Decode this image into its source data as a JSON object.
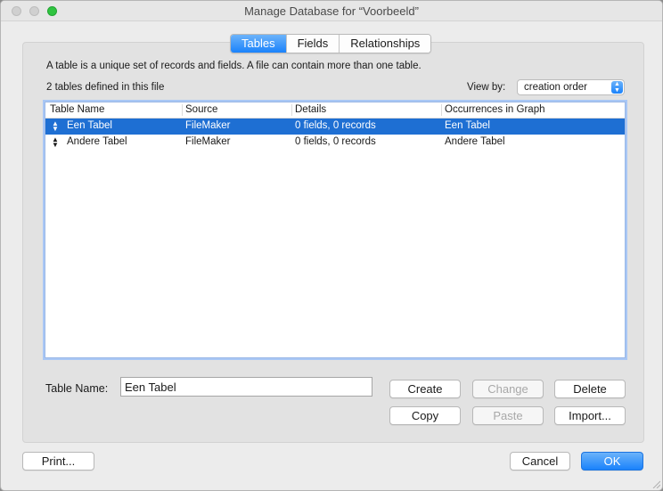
{
  "window": {
    "title": "Manage Database for “Voorbeeld”"
  },
  "tabs": [
    {
      "label": "Tables",
      "active": true
    },
    {
      "label": "Fields",
      "active": false
    },
    {
      "label": "Relationships",
      "active": false
    }
  ],
  "description": "A table is a unique set of records and fields. A file can contain more than one table.",
  "count_text": "2 tables defined in this file",
  "view_by": {
    "label": "View by:",
    "value": "creation order"
  },
  "table_list": {
    "columns": [
      "Table Name",
      "Source",
      "Details",
      "Occurrences in Graph"
    ],
    "rows": [
      {
        "name": "Een Tabel",
        "source": "FileMaker",
        "details": "0 fields, 0 records",
        "occurrences": "Een Tabel",
        "selected": true
      },
      {
        "name": "Andere Tabel",
        "source": "FileMaker",
        "details": "0 fields, 0 records",
        "occurrences": "Andere Tabel",
        "selected": false
      }
    ]
  },
  "table_name": {
    "label": "Table Name:",
    "value": "Een Tabel"
  },
  "buttons": {
    "create": "Create",
    "change": "Change",
    "delete": "Delete",
    "copy": "Copy",
    "paste": "Paste",
    "import": "Import...",
    "print": "Print...",
    "cancel": "Cancel",
    "ok": "OK"
  },
  "colors": {
    "accent": "#1a82fb",
    "selection": "#1e6fd3"
  }
}
